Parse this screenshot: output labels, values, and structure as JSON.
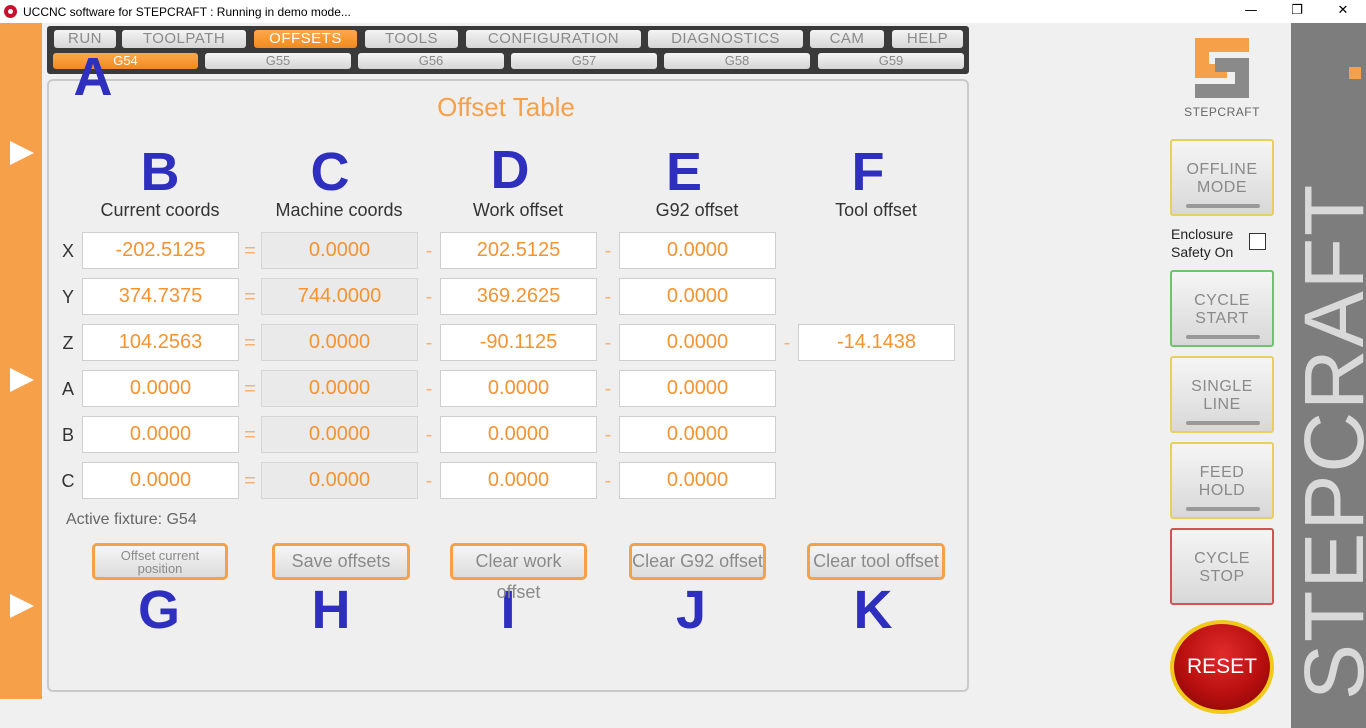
{
  "window": {
    "title": "UCCNC software for STEPCRAFT : Running in demo mode...",
    "minimize": "—",
    "maximize": "❐",
    "close": "✕"
  },
  "nav": {
    "tabs": [
      "RUN",
      "TOOLPATH",
      "OFFSETS",
      "TOOLS",
      "CONFIGURATION",
      "DIAGNOSTICS",
      "CAM",
      "HELP"
    ],
    "active_tab": "OFFSETS",
    "subtabs": [
      "G54",
      "G55",
      "G56",
      "G57",
      "G58",
      "G59"
    ],
    "active_subtab": "G54"
  },
  "panel": {
    "title": "Offset Table",
    "column_headers": {
      "current": "Current coords",
      "machine": "Machine coords",
      "work": "Work offset",
      "g92": "G92 offset",
      "tool": "Tool offset"
    },
    "rows": [
      {
        "axis": "X",
        "current": "-202.5125",
        "machine": "0.0000",
        "work": "202.5125",
        "g92": "0.0000"
      },
      {
        "axis": "Y",
        "current": "374.7375",
        "machine": "744.0000",
        "work": "369.2625",
        "g92": "0.0000"
      },
      {
        "axis": "Z",
        "current": "104.2563",
        "machine": "0.0000",
        "work": "-90.1125",
        "g92": "0.0000",
        "tool": "-14.1438"
      },
      {
        "axis": "A",
        "current": "0.0000",
        "machine": "0.0000",
        "work": "0.0000",
        "g92": "0.0000"
      },
      {
        "axis": "B",
        "current": "0.0000",
        "machine": "0.0000",
        "work": "0.0000",
        "g92": "0.0000"
      },
      {
        "axis": "C",
        "current": "0.0000",
        "machine": "0.0000",
        "work": "0.0000",
        "g92": "0.0000"
      }
    ],
    "ops": {
      "eq": "=",
      "minus": "-"
    },
    "active_fixture": "Active fixture: G54",
    "buttons": {
      "offset_current_line1": "Offset current",
      "offset_current_line2": "position",
      "save_offsets": "Save  offsets",
      "clear_work": "Clear work offset",
      "clear_g92": "Clear G92 offset",
      "clear_tool": "Clear tool offset"
    }
  },
  "annotations": [
    "A",
    "B",
    "C",
    "D",
    "E",
    "F",
    "G",
    "H",
    "I",
    "J",
    "K"
  ],
  "right": {
    "logo_text": "STEPCRAFT",
    "brand_vertical": "STEPCRAFT",
    "offline_mode_line1": "OFFLINE",
    "offline_mode_line2": "MODE",
    "enclosure_line1": "Enclosure",
    "enclosure_line2": "Safety On",
    "cycle_start_line1": "CYCLE",
    "cycle_start_line2": "START",
    "single_line_line1": "SINGLE",
    "single_line_line2": "LINE",
    "feed_hold_line1": "FEED",
    "feed_hold_line2": "HOLD",
    "cycle_stop_line1": "CYCLE",
    "cycle_stop_line2": "STOP",
    "reset": "RESET"
  },
  "colors": {
    "accent": "#f7a04a",
    "annotation": "#2f2fbf",
    "reset": "#b80f0f"
  }
}
